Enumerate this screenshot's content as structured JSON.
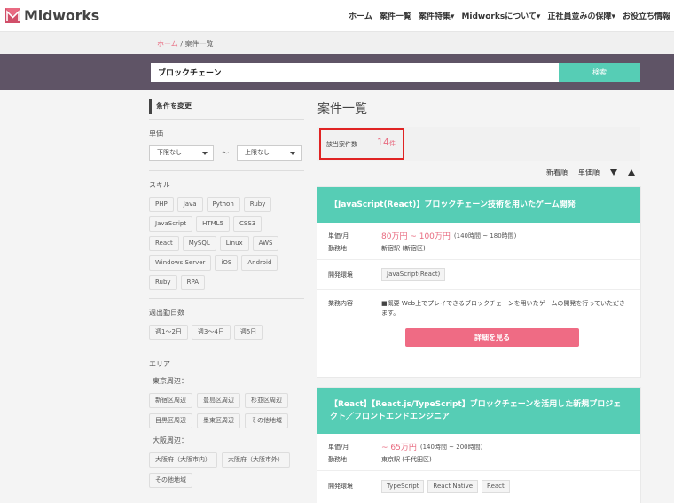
{
  "header": {
    "logo_text": "Midworks",
    "nav": [
      "ホーム",
      "案件一覧",
      "案件特集▾",
      "Midworksについて▾",
      "正社員並みの保障▾",
      "お役立ち情報"
    ]
  },
  "breadcrumb": {
    "home": "ホーム",
    "separator": "/",
    "current": "案件一覧"
  },
  "search": {
    "value": "ブロックチェーン",
    "button": "検索"
  },
  "sidebar": {
    "title": "条件を変更",
    "price_label": "単価",
    "price_min": "下限なし",
    "price_tilde": "〜",
    "price_max": "上限なし",
    "skill_label": "スキル",
    "skills": [
      "PHP",
      "Java",
      "Python",
      "Ruby",
      "JavaScript",
      "HTML5",
      "CSS3",
      "React",
      "MySQL",
      "Linux",
      "AWS",
      "Windows Server",
      "iOS",
      "Android",
      "Ruby",
      "RPA"
    ],
    "days_label": "週出勤日数",
    "days": [
      "週1〜2日",
      "週3〜4日",
      "週5日"
    ],
    "area_label": "エリア",
    "tokyo_label": "東京周辺：",
    "tokyo": [
      "新宿区周辺",
      "豊島区周辺",
      "杉並区周辺",
      "目黒区周辺",
      "墨東区周辺",
      "その他地域"
    ],
    "osaka_label": "大阪周辺：",
    "osaka": [
      "大阪府（大阪市内）",
      "大阪府（大阪市外）",
      "その他地域"
    ]
  },
  "main": {
    "title": "案件一覧",
    "count_label": "該当案件数",
    "count": "14",
    "count_unit": "件",
    "sort": {
      "newest": "新着順",
      "price": "単価順"
    },
    "cards": [
      {
        "title": "【JavaScript(React)】ブロックチェーン技術を用いたゲーム開発",
        "price_key": "単価/月",
        "price": "80万円 ~ 100万円",
        "price_hours": "(140時間 ~ 180時間)",
        "location_key": "勤務地",
        "location": "新宿駅 (新宿区)",
        "env_key": "開発環境",
        "env": [
          "JavaScript(React)"
        ],
        "desc_key": "業務内容",
        "desc": "■概要 Web上でプレイできるブロックチェーンを用いたゲームの開発を行っていただきます。",
        "button": "詳細を見る"
      },
      {
        "title": "【React】【React.js/TypeScript】ブロックチェーンを活用した新規プロジェクト／フロントエンドエンジニア",
        "price_key": "単価/月",
        "price": "~ 65万円",
        "price_hours": "(140時間 ~ 200時間)",
        "location_key": "勤務地",
        "location": "東京駅 (千代田区)",
        "env_key": "開発環境",
        "env": [
          "TypeScript",
          "React Native",
          "React"
        ]
      }
    ]
  },
  "colors": {
    "accent": "#56cdb5",
    "pink": "#ef6b84",
    "band": "#5f5466",
    "highlight": "#e02323"
  }
}
